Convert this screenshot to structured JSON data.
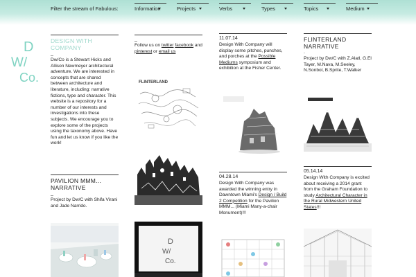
{
  "header": {
    "filter_label": "Filter the stream of Fabulous:",
    "nav": [
      {
        "label": "Information"
      },
      {
        "label": "Projects"
      },
      {
        "label": "Verbs"
      },
      {
        "label": "Types"
      },
      {
        "label": "Topics"
      },
      {
        "label": "Medium"
      }
    ]
  },
  "logo": {
    "line1": "D",
    "line2": "W/",
    "line3": "Co."
  },
  "col1": {
    "card1": {
      "title": "DESIGN WITH COMPANY",
      "dash": "_",
      "body": "Dw/Co is a Stewart Hicks and Allison Newmeyer architectural adventure. We are interested in concepts that are shared between architecture and literature, including: narrative fictions, type and character. This website is a repository for a number of our interests and investigations into these subjects. We encourage you to explore some of the projects using the taxonomy above. Have fun and let us know if you like the work!"
    },
    "card2": {
      "title": "PAVILION MMM... NARRATIVE",
      "dash": "_",
      "body": "Project by Dw/C with Shifa Virani and Jade Narrido."
    }
  },
  "col2": {
    "card1": {
      "dash": "_",
      "follow": "Follow us on",
      "twitter": "twitter",
      "facebook": "facebook",
      "and": "and",
      "pinterest": "pinterest",
      "or": "or",
      "email": "email us"
    },
    "thumb1_title": "FLINTERLAND"
  },
  "col3": {
    "card1": {
      "date": "11.07.14",
      "body_a": "Design With Company will display some pitches, punches, and porches at the",
      "link": "Possible Mediums",
      "body_b": "symposium and exhibition at the Fisher Center."
    },
    "card2": {
      "date": "04.28.14",
      "body_a": "Design With Company was awarded the winning entry in Dawntown Miami's",
      "link": "Design / Build 2 Competition",
      "body_b": "for the Pavilion MMM... (Miami Many-a-chair Monument)!!!"
    }
  },
  "col4": {
    "card1": {
      "title": "FLINTERLAND NARRATIVE",
      "dash": ".",
      "body": "Project by Dw/C with Z.Alatl, G.El Tayer, M.Nava, M.Seeley, N.Sonbol, B.Sprite, T.Walker"
    },
    "card2": {
      "date": "05.14.14",
      "body_a": "Design With Company is excited about receiving a 2014 grant from the Graham Foundation to study",
      "link": "Architectural Character in the Rural Midwestern United States",
      "body_b": "!!!"
    }
  },
  "colors": {
    "accent": "#7fd3c2",
    "bar": "#aee0d4"
  }
}
